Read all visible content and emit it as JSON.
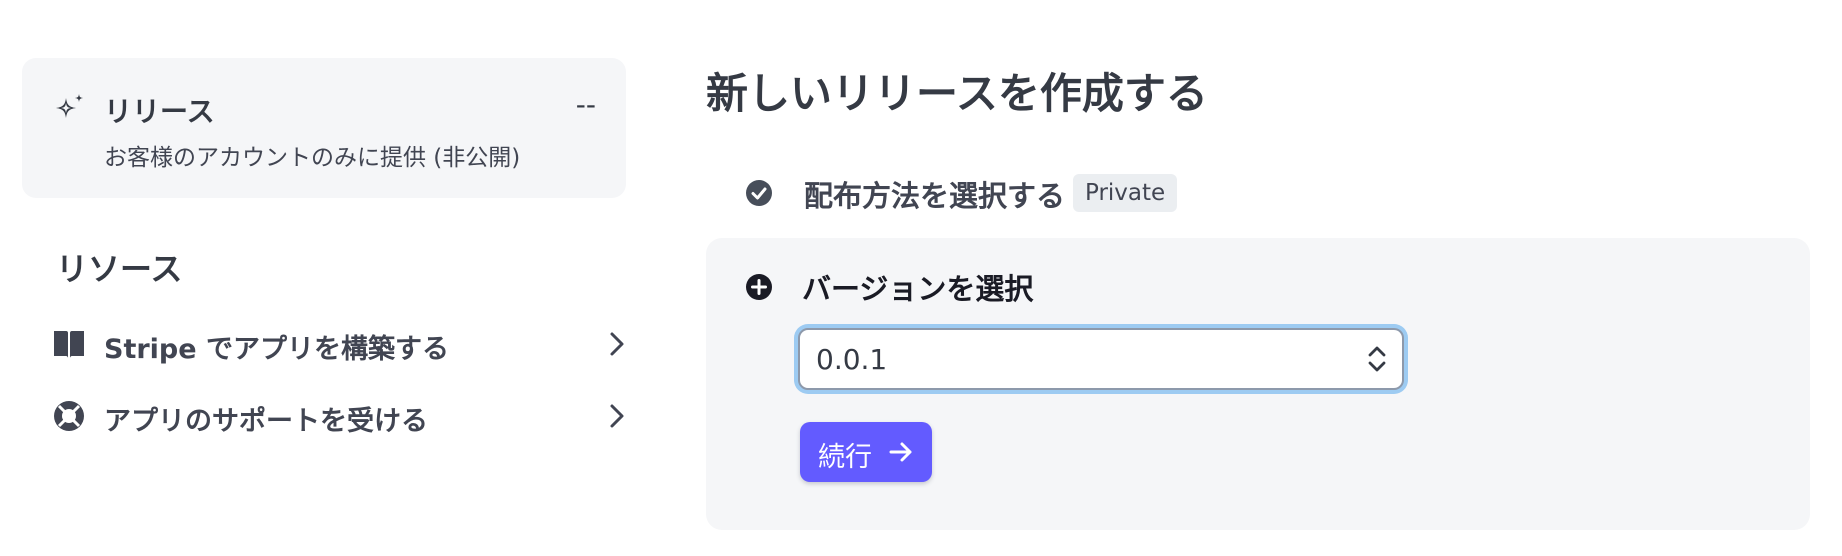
{
  "release_card": {
    "title": "リリース",
    "status": "--",
    "subtitle": "お客様のアカウントのみに提供 (非公開)",
    "icon": "sparkle-icon"
  },
  "resources": {
    "heading": "リソース",
    "items": [
      {
        "label": "Stripe でアプリを構築する",
        "icon": "book-icon"
      },
      {
        "label": "アプリのサポートを受ける",
        "icon": "lifebuoy-icon"
      }
    ]
  },
  "main": {
    "title": "新しいリリースを作成する",
    "step1": {
      "label": "配布方法を選択する",
      "badge": "Private",
      "icon": "check-circle-icon"
    },
    "step2": {
      "label": "バージョンを選択",
      "icon": "plus-circle-icon",
      "select_value": "0.0.1",
      "button_label": "続行"
    }
  },
  "colors": {
    "accent": "#635bff",
    "focus_ring": "#9dcbf2",
    "panel_bg": "#f5f6f8",
    "text": "#414552"
  }
}
